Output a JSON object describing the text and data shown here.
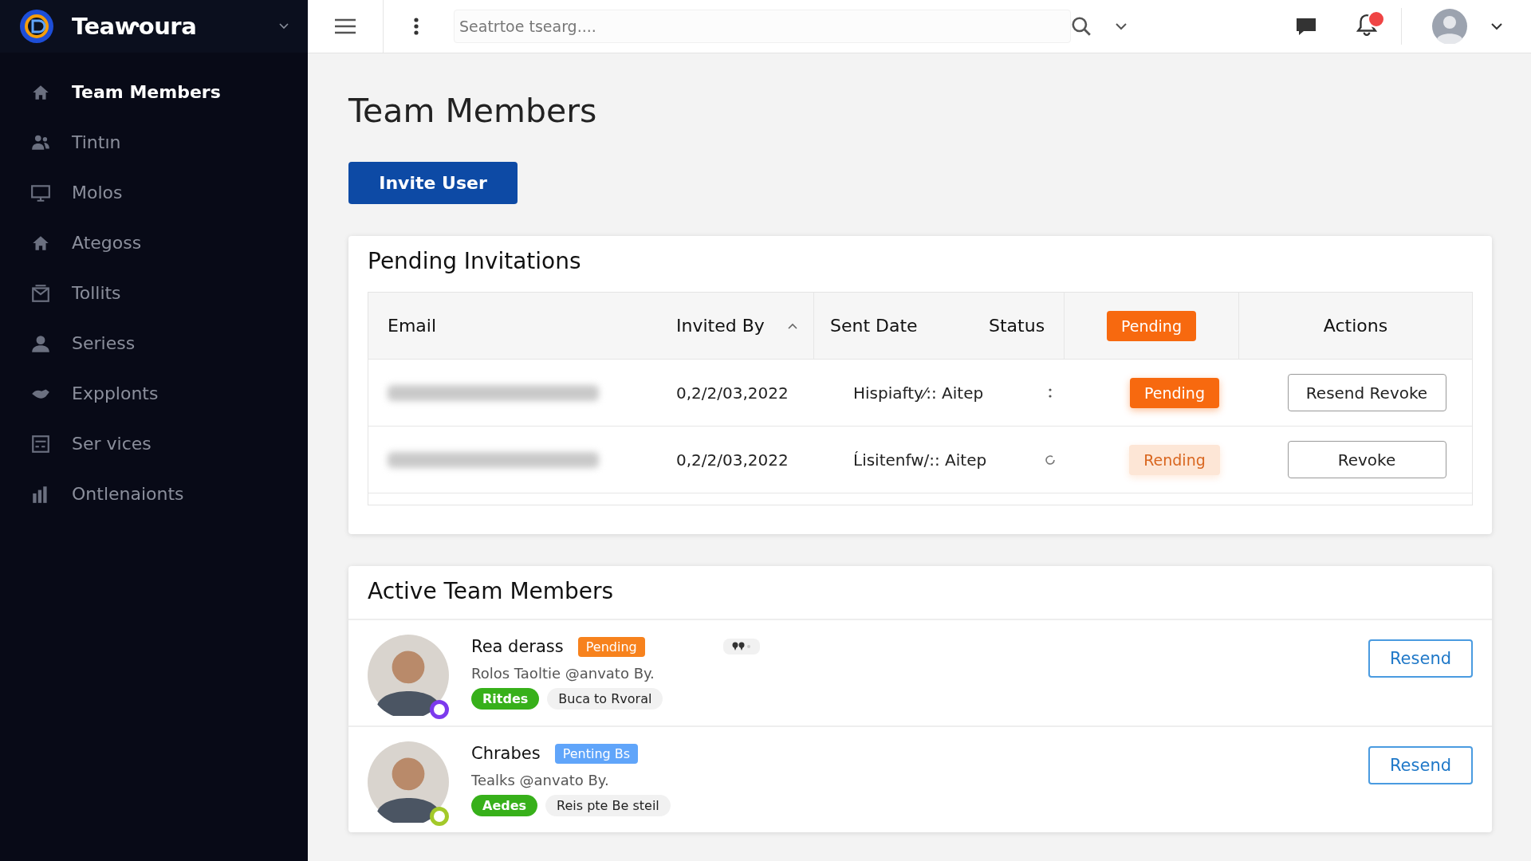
{
  "brand": {
    "name": "Teaⱳoura"
  },
  "sidebar": {
    "items": [
      {
        "label": "Team Members",
        "selected": true
      },
      {
        "label": "Tintın",
        "selected": false
      },
      {
        "label": "Molos",
        "selected": false
      },
      {
        "label": "Ategoss",
        "selected": false
      },
      {
        "label": "Tollits",
        "selected": false
      },
      {
        "label": "Seriess",
        "selected": false
      },
      {
        "label": "Expplonts",
        "selected": false
      },
      {
        "label": "Ser vices",
        "selected": false
      },
      {
        "label": "Ontlenaionts",
        "selected": false
      }
    ]
  },
  "topbar": {
    "search": {
      "placeholder": "Seatrtoe tsearg...."
    }
  },
  "page": {
    "title": "Team Members",
    "invite_button": "Invite User"
  },
  "pending": {
    "title": "Pending Invitations",
    "columns": [
      "Email",
      "Invited By",
      "Sent Date",
      "Status"
    ],
    "header_badge": "Pending",
    "actions_header": "Actions",
    "rows": [
      {
        "date": "0,2/2/03,2022",
        "sent": "Hispiafty⁄:: Aitep",
        "badge": "Pending",
        "faded": false,
        "actions": [
          "Resend Revoke"
        ]
      },
      {
        "date": "0,2/2/03,2022",
        "sent": "Ĺisitenfw/:: Aitep",
        "badge": "Rending",
        "faded": true,
        "actions": [
          "Revoke"
        ]
      }
    ]
  },
  "active": {
    "title": "Active Team Members",
    "members": [
      {
        "name": "Rea derass",
        "badge": {
          "label": "Pending",
          "color": "#f7821d"
        },
        "chip": true,
        "subtitle": "Rolos Taoltie @anvato By.",
        "color": "#7c3aed",
        "tags": [
          {
            "label": "Ritdes",
            "kind": "green"
          },
          {
            "label": "Buca to Rvoral",
            "kind": "grey"
          }
        ],
        "button": "Resend"
      },
      {
        "name": "Chrabes",
        "badge": {
          "label": "Penting Bs",
          "color": "#60a5fa"
        },
        "chip": false,
        "subtitle": "Tealks @anvato By.",
        "color": "#a3c92a",
        "tags": [
          {
            "label": "Aedes",
            "kind": "green"
          },
          {
            "label": "Reis pte Be steil",
            "kind": "grey"
          }
        ],
        "button": "Resend"
      }
    ]
  }
}
